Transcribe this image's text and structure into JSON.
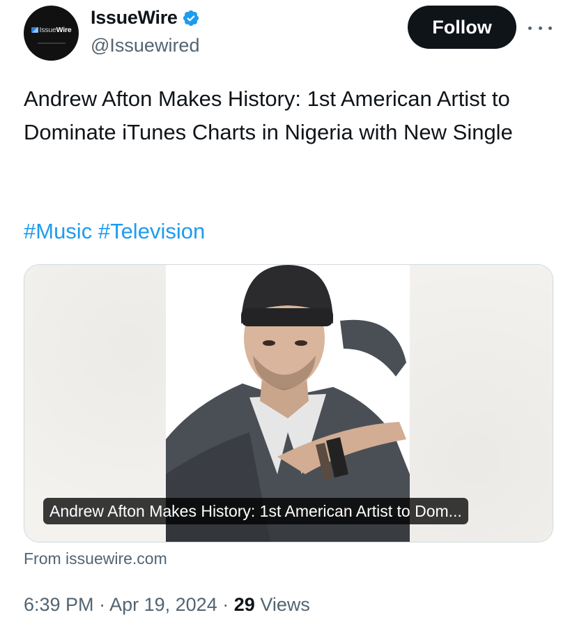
{
  "author": {
    "avatar_brand_prefix": "Issue",
    "avatar_brand_suffix": "Wire",
    "display_name": "IssueWire",
    "handle": "@Issuewired",
    "verified": true
  },
  "actions": {
    "follow_label": "Follow"
  },
  "tweet": {
    "text": "Andrew Afton Makes History: 1st American Artist to Dominate iTunes Charts in Nigeria with New Single",
    "hashtags": [
      "#Music",
      "#Television"
    ]
  },
  "card": {
    "caption": "Andrew Afton Makes History: 1st American Artist to Dom...",
    "source": "From issuewire.com"
  },
  "meta": {
    "time": "6:39 PM",
    "separator": "·",
    "date": "Apr 19, 2024",
    "views_count": "29",
    "views_label": "Views"
  },
  "colors": {
    "link": "#1d9bf0",
    "text_primary": "#0f1419",
    "text_secondary": "#536471",
    "verified_badge": "#1d9bf0"
  }
}
